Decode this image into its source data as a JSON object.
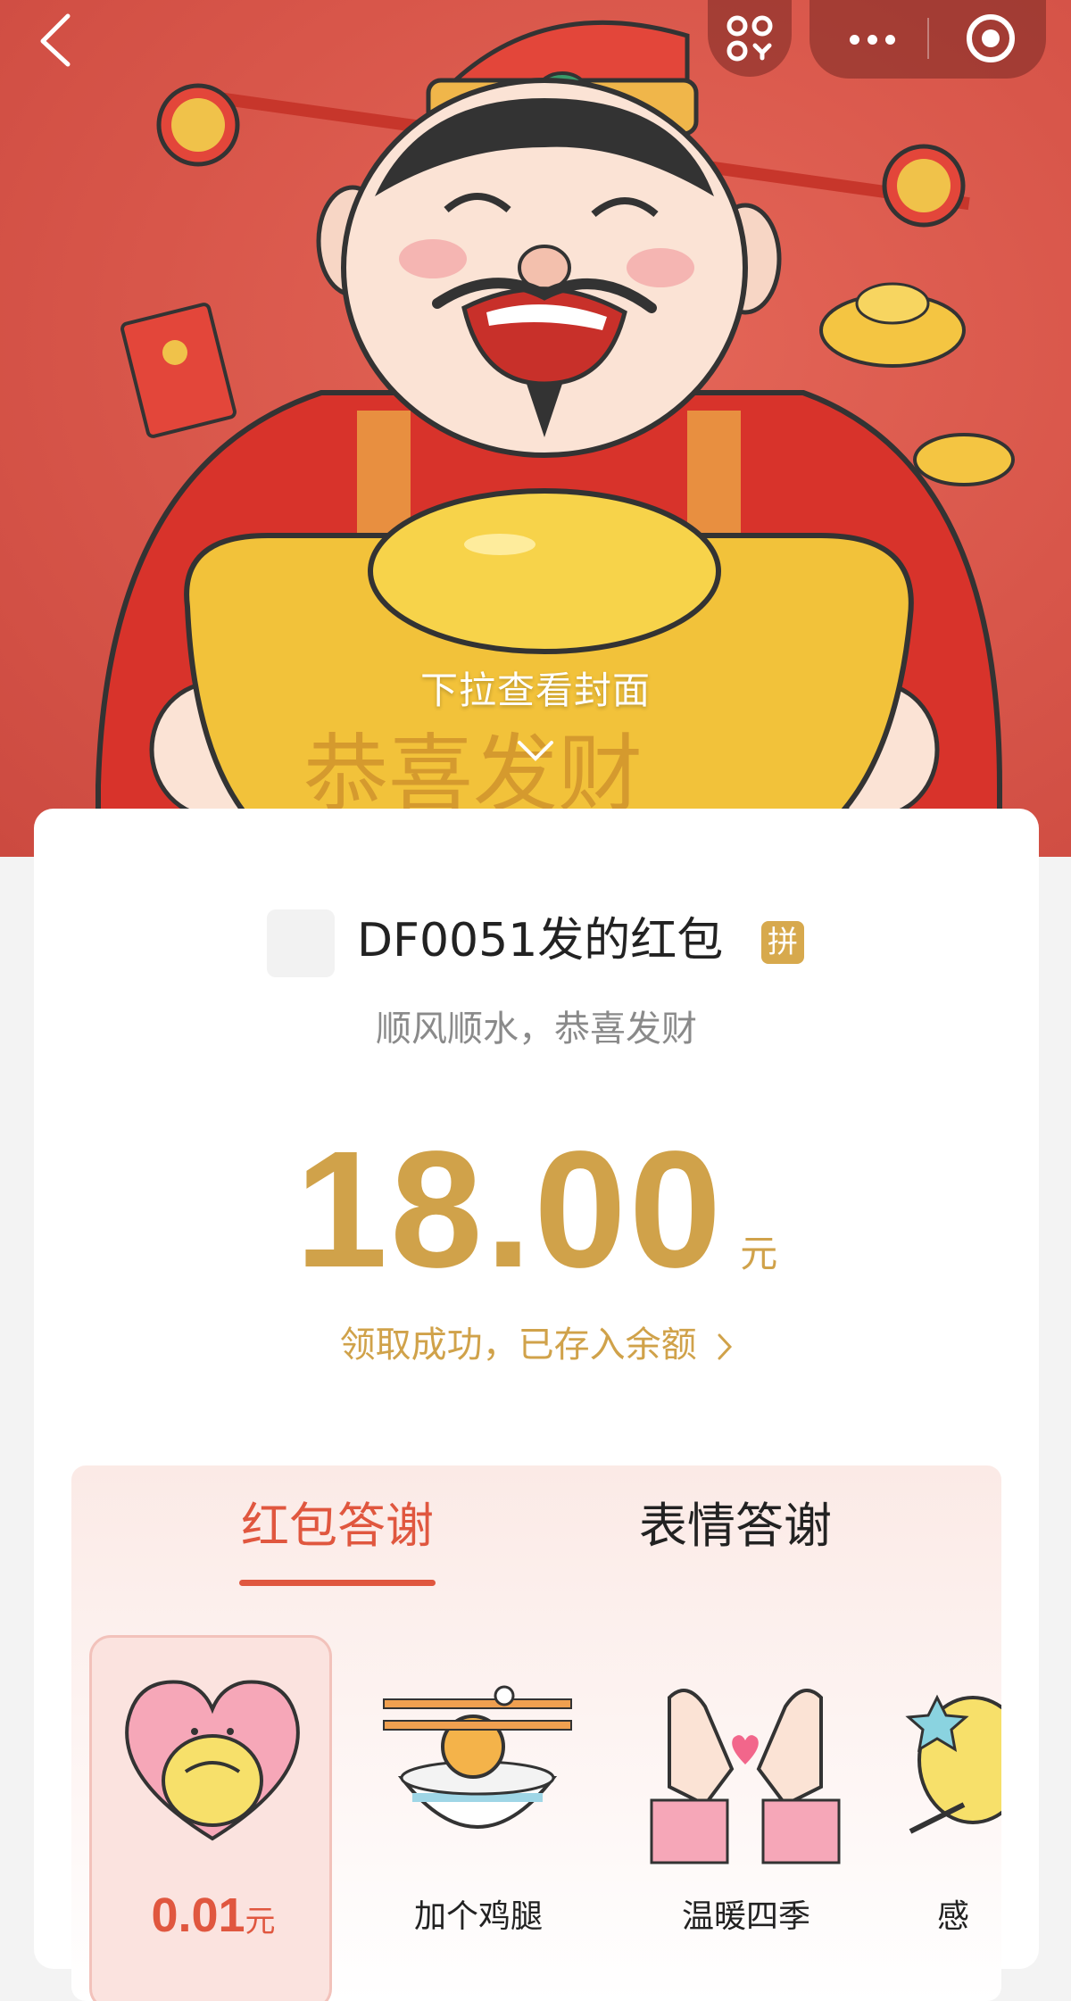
{
  "hero": {
    "pull_hint": "下拉查看封面",
    "ingot_text": "恭喜发财"
  },
  "nav": {
    "back_icon": "chevron-left-icon",
    "scan_icon": "scan-icon",
    "more_icon": "more-dots-icon",
    "close_icon": "target-close-icon"
  },
  "packet": {
    "sender_name": "DF0051发的红包",
    "badge": "拼",
    "greeting": "顺风顺水，恭喜发财",
    "amount": "18.00",
    "unit": "元",
    "status": "领取成功，已存入余额"
  },
  "thanks": {
    "tabs": [
      {
        "label": "红包答谢",
        "active": true
      },
      {
        "label": "表情答谢",
        "active": false
      }
    ],
    "gifts": [
      {
        "price": "0.01",
        "unit": "元",
        "icon": "heart-hug-icon",
        "selected": true
      },
      {
        "label": "加个鸡腿",
        "icon": "chicken-leg-bowl-icon"
      },
      {
        "label": "温暖四季",
        "icon": "finger-heart-icon"
      },
      {
        "label": "感",
        "icon": "star-mascot-icon"
      }
    ]
  },
  "colors": {
    "hero_red": "#d8564a",
    "gold": "#d0a24a",
    "accent_red": "#e0573f"
  }
}
